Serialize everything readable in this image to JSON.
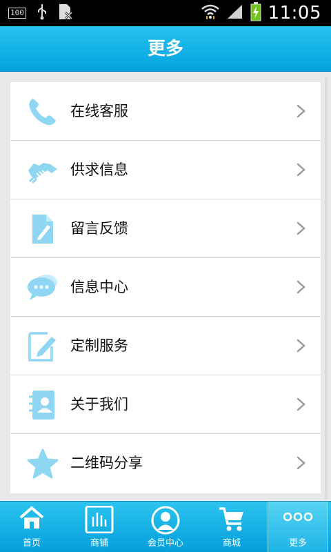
{
  "status_bar": {
    "battery_badge": "100",
    "time": "11:05"
  },
  "header": {
    "title": "更多"
  },
  "menu": {
    "items": [
      {
        "label": "在线客服",
        "icon": "phone-icon"
      },
      {
        "label": "供求信息",
        "icon": "handshake-icon"
      },
      {
        "label": "留言反馈",
        "icon": "document-pen-icon"
      },
      {
        "label": "信息中心",
        "icon": "chat-bubbles-icon"
      },
      {
        "label": "定制服务",
        "icon": "edit-icon"
      },
      {
        "label": "关于我们",
        "icon": "contact-card-icon"
      },
      {
        "label": "二维码分享",
        "icon": "star-icon"
      }
    ]
  },
  "bottom_nav": {
    "tabs": [
      {
        "label": "首页",
        "icon": "home-icon"
      },
      {
        "label": "商铺",
        "icon": "bar-chart-icon"
      },
      {
        "label": "会员中心",
        "icon": "user-icon"
      },
      {
        "label": "商城",
        "icon": "cart-icon"
      },
      {
        "label": "更多",
        "icon": "more-dots-icon",
        "active": true
      }
    ]
  },
  "colors": {
    "accent": "#04a2de",
    "icon_blue": "#8fd6f2",
    "chevron": "#9a9a9a"
  }
}
